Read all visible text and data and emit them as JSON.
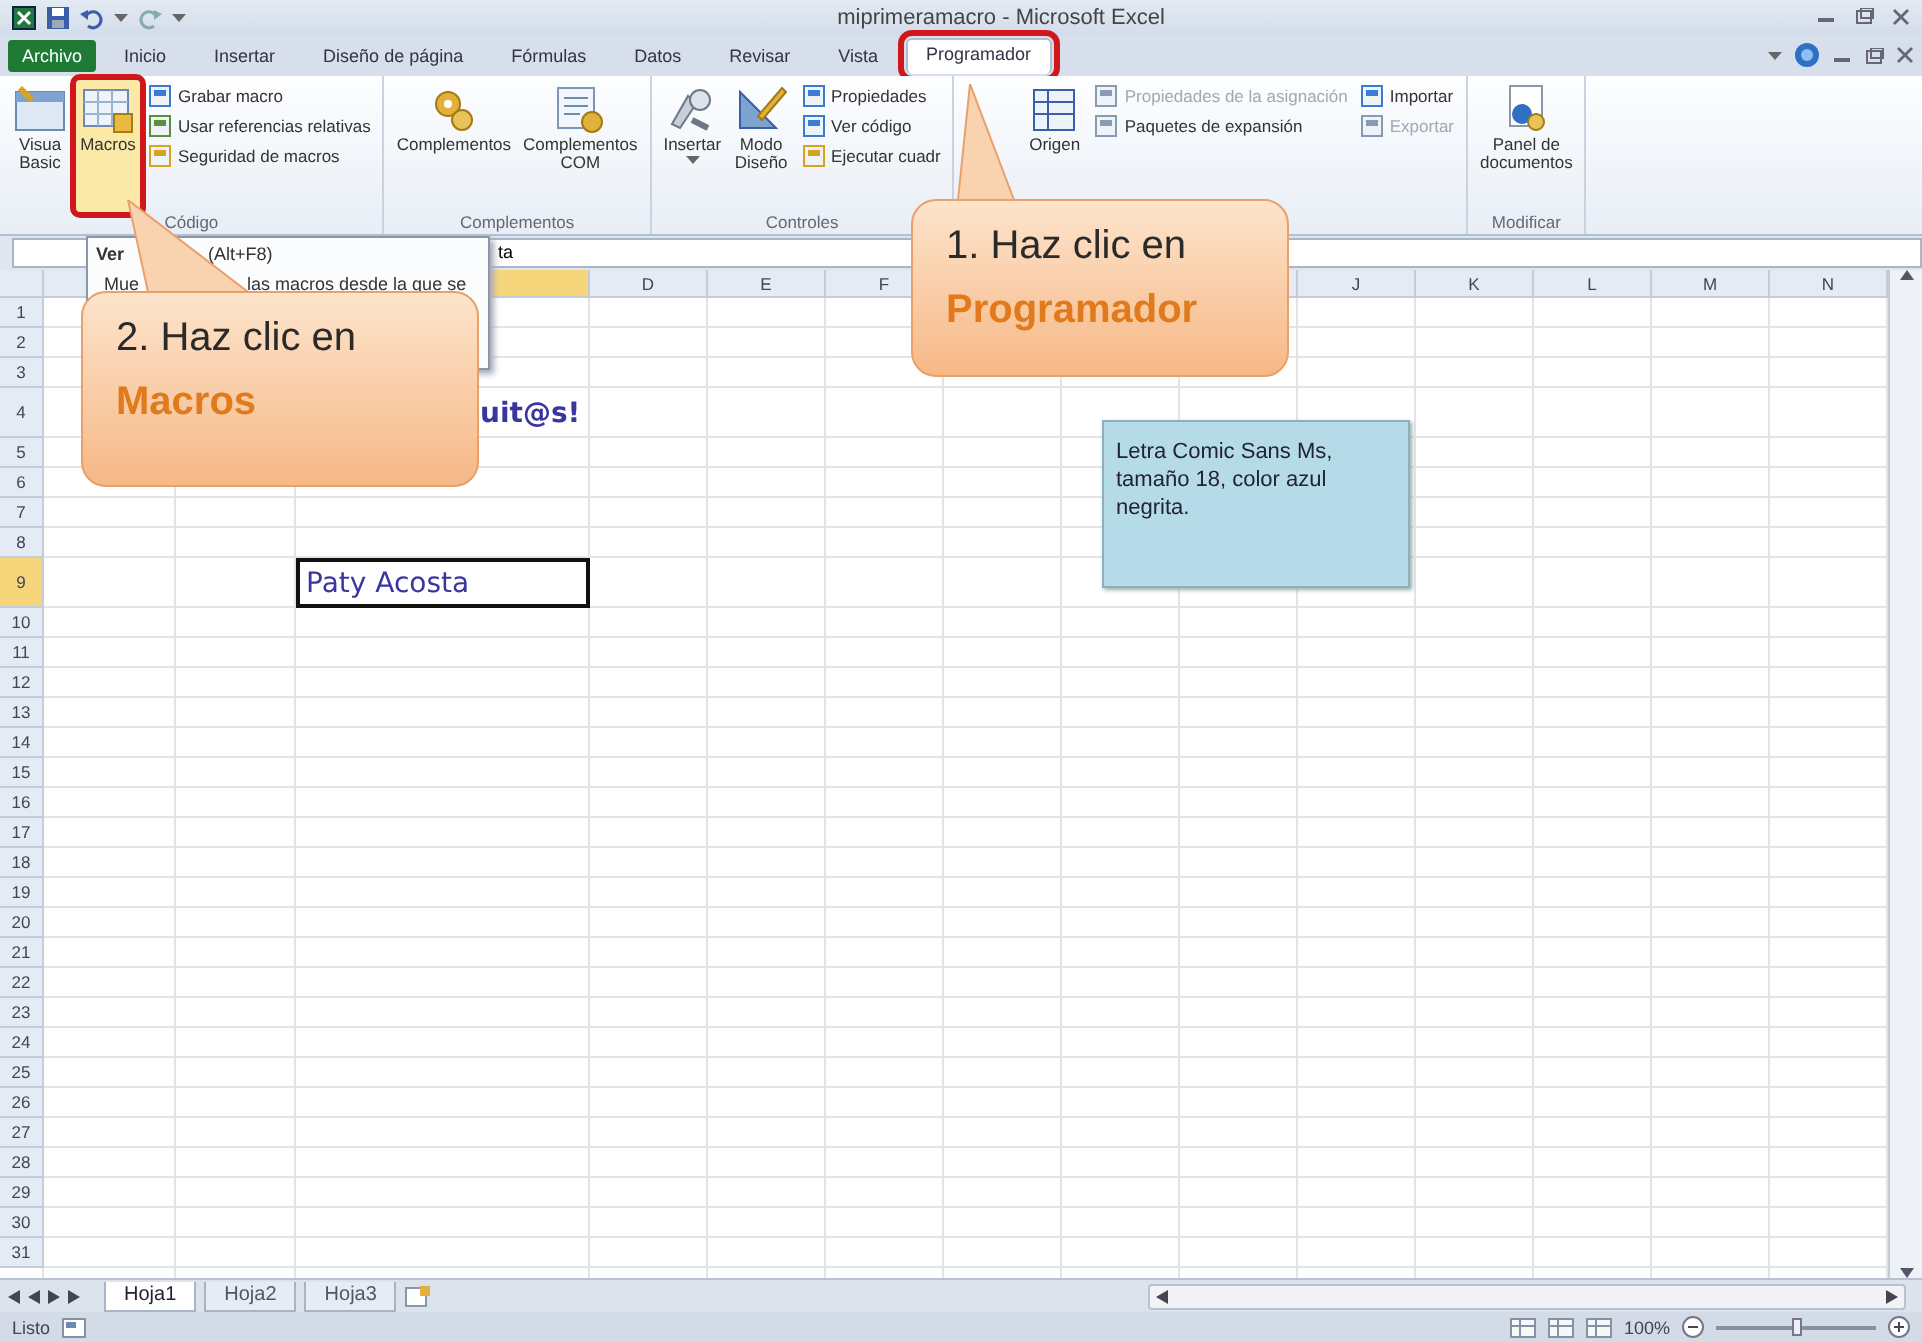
{
  "window": {
    "title": "miprimeramacro - Microsoft Excel"
  },
  "ribbon_tabs": [
    {
      "label": "Archivo",
      "kind": "file",
      "selected": false,
      "highlighted": false
    },
    {
      "label": "Inicio",
      "kind": "tab",
      "selected": false,
      "highlighted": false
    },
    {
      "label": "Insertar",
      "kind": "tab",
      "selected": false,
      "highlighted": false
    },
    {
      "label": "Diseño de página",
      "kind": "tab",
      "selected": false,
      "highlighted": false
    },
    {
      "label": "Fórmulas",
      "kind": "tab",
      "selected": false,
      "highlighted": false
    },
    {
      "label": "Datos",
      "kind": "tab",
      "selected": false,
      "highlighted": false
    },
    {
      "label": "Revisar",
      "kind": "tab",
      "selected": false,
      "highlighted": false
    },
    {
      "label": "Vista",
      "kind": "tab",
      "selected": false,
      "highlighted": false
    },
    {
      "label": "Programador",
      "kind": "tab",
      "selected": true,
      "highlighted": true
    }
  ],
  "ribbon_groups": [
    {
      "label": "Código",
      "buttons": [
        {
          "kind": "large",
          "lines": [
            "Visua",
            "Basic"
          ],
          "highlighted": false
        },
        {
          "kind": "large",
          "lines": [
            "Macros"
          ],
          "highlighted": true
        },
        {
          "kind": "stack",
          "items": [
            {
              "label": "Grabar macro",
              "disabled": false
            },
            {
              "label": "Usar referencias relativas",
              "disabled": false
            },
            {
              "label": "Seguridad de macros",
              "disabled": false
            }
          ]
        }
      ]
    },
    {
      "label": "Complementos",
      "buttons": [
        {
          "kind": "large",
          "lines": [
            "Complementos"
          ],
          "highlighted": false
        },
        {
          "kind": "large",
          "lines": [
            "Complementos",
            "COM"
          ],
          "highlighted": false
        }
      ]
    },
    {
      "label": "Controles",
      "buttons": [
        {
          "kind": "large",
          "lines": [
            "Insertar"
          ],
          "dropdown": true,
          "highlighted": false
        },
        {
          "kind": "large",
          "lines": [
            "Modo",
            "Diseño"
          ],
          "highlighted": false
        },
        {
          "kind": "stack",
          "items": [
            {
              "label": "Propiedades",
              "disabled": false
            },
            {
              "label": "Ver código",
              "disabled": false
            },
            {
              "label": "Ejecutar cuadr",
              "disabled": false
            }
          ]
        }
      ]
    },
    {
      "buttons": [
        {
          "kind": "large",
          "lines": [
            "Origen"
          ],
          "highlighted": false
        },
        {
          "kind": "stack",
          "items": [
            {
              "label": "Propiedades de la asignación",
              "disabled": true
            },
            {
              "label": "Paquetes de expansión",
              "disabled": false
            }
          ]
        },
        {
          "kind": "stack",
          "items": [
            {
              "label": "Importar",
              "disabled": false
            },
            {
              "label": "Exportar",
              "disabled": true
            }
          ]
        }
      ]
    },
    {
      "label": "Modificar",
      "buttons": [
        {
          "kind": "large",
          "lines": [
            "Panel de",
            "documentos"
          ],
          "highlighted": false
        }
      ]
    }
  ],
  "formula_bar": {
    "value": "ta"
  },
  "macro_tooltip": {
    "title": "Ver",
    "shortcut": "(Alt+F8)",
    "description_start": "Mue",
    "description_rest": "las macros desde la que se"
  },
  "sheet": {
    "columns": [
      {
        "selected": false
      },
      {},
      {
        "selected": true
      },
      {
        "label": "D",
        "selected": false
      },
      {
        "label": "E",
        "selected": false
      },
      {
        "label": "F",
        "selected": false
      },
      {},
      {},
      {
        "selected": false
      },
      {
        "label": "J",
        "selected": false
      },
      {
        "label": "K",
        "selected": false
      },
      {
        "label": "L",
        "selected": false
      },
      {
        "label": "M",
        "selected": false
      },
      {
        "label": "N",
        "selected": false
      }
    ],
    "rows": [
      {
        "label": "1",
        "selected": false
      },
      {
        "label": "2",
        "selected": false
      },
      {
        "label": "3",
        "selected": false
      },
      {
        "label": "4",
        "selected": false,
        "cells": [
          null,
          null,
          {
            "text": "uit@s!",
            "kind": "title"
          }
        ]
      },
      {
        "label": "5",
        "selected": false
      },
      {
        "label": "6",
        "selected": false
      },
      {
        "label": "7",
        "selected": false
      },
      {
        "label": "8",
        "selected": false
      },
      {
        "label": "9",
        "selected": true,
        "cells": [
          null,
          null,
          {
            "text": "Paty Acosta",
            "kind": "bordered"
          }
        ]
      },
      {
        "label": "10",
        "selected": false
      },
      {
        "label": "11",
        "selected": false
      },
      {
        "label": "12",
        "selected": false
      },
      {
        "label": "13",
        "selected": false
      },
      {
        "label": "14",
        "selected": false
      },
      {
        "label": "15",
        "selected": false
      },
      {
        "label": "16",
        "selected": false
      },
      {
        "label": "17",
        "selected": false
      },
      {
        "label": "18",
        "selected": false
      },
      {
        "label": "19",
        "selected": false
      },
      {
        "label": "20",
        "selected": false
      },
      {
        "label": "21",
        "selected": false
      },
      {
        "label": "22",
        "selected": false
      },
      {
        "label": "23",
        "selected": false
      },
      {
        "label": "24",
        "selected": false
      },
      {
        "label": "25",
        "selected": false
      },
      {
        "label": "26",
        "selected": false
      },
      {
        "label": "27",
        "selected": false
      },
      {
        "label": "28",
        "selected": false
      },
      {
        "label": "29",
        "selected": false
      },
      {
        "label": "30",
        "selected": false
      },
      {
        "label": "31",
        "selected": false
      }
    ]
  },
  "text_box": {
    "text": "Letra Comic Sans Ms, tamaño 18, color azul negrita."
  },
  "callouts": [
    {
      "line": "1. Haz clic en",
      "highlight": "Programador"
    },
    {
      "line": "2. Haz clic en",
      "highlight": "Macros"
    }
  ],
  "sheet_tabs": [
    {
      "label": "Hoja1",
      "selected": true
    },
    {
      "label": "Hoja2",
      "selected": false
    },
    {
      "label": "Hoja3",
      "selected": false
    }
  ],
  "status_bar": {
    "status": "Listo",
    "zoom": "100%",
    "zoom_slider": {
      "level": 0.5
    }
  }
}
